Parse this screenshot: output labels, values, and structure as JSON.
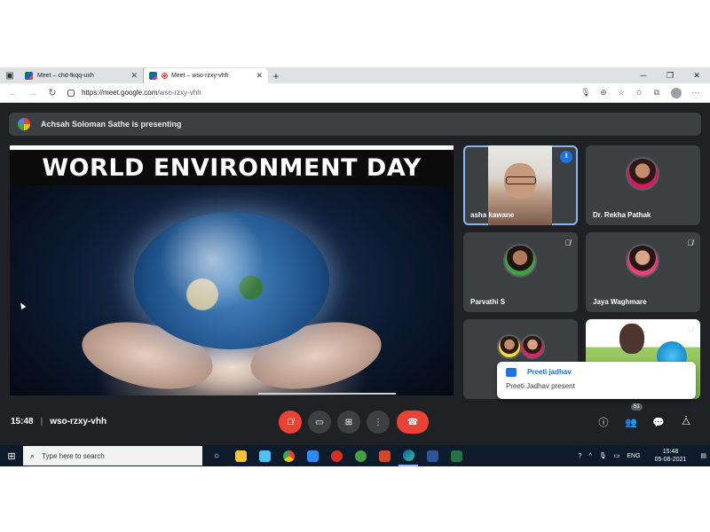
{
  "browser": {
    "tabs": [
      {
        "title": "Meet – chd-fkqq-uxh",
        "active": false
      },
      {
        "title": "Meet – wso-rzxy-vhh",
        "active": true,
        "recording": true
      }
    ],
    "new_tab_label": "+",
    "window_controls": {
      "minimize": "─",
      "restore": "❐",
      "close": "✕"
    },
    "url_host": "https://meet.google.com",
    "url_path": "/wso-rzxy-vhh"
  },
  "meet": {
    "presenting_banner": "Achsah Soloman Sathe is presenting",
    "slide_title": "WORLD ENVIRONMENT DAY",
    "participants": [
      {
        "name": "asha kawane",
        "speaking": true,
        "muted": false
      },
      {
        "name": "Dr. Rekha Pathak",
        "speaking": false,
        "muted": false
      },
      {
        "name": "Parvathi S",
        "speaking": false,
        "muted": true
      },
      {
        "name": "Jaya Waghmare",
        "speaking": false,
        "muted": true
      },
      {
        "name": "",
        "speaking": false,
        "muted": false
      },
      {
        "name": "",
        "speaking": false,
        "muted": true
      }
    ],
    "toast": {
      "title": "Preeti jadhav",
      "body": "Preeti Jadhav present"
    },
    "time": "15:48",
    "meeting_code": "wso-rzxy-vhh",
    "participant_count": "51"
  },
  "taskbar": {
    "search_placeholder": "Type here to search",
    "language": "ENG",
    "time": "15:48",
    "date": "05-06-2021"
  },
  "colors": {
    "meet_bg": "#202124",
    "tile_bg": "#3c4043",
    "accent_blue": "#1a73e8",
    "end_call_red": "#ea4335",
    "taskbar_bg": "#0d1b2a"
  }
}
